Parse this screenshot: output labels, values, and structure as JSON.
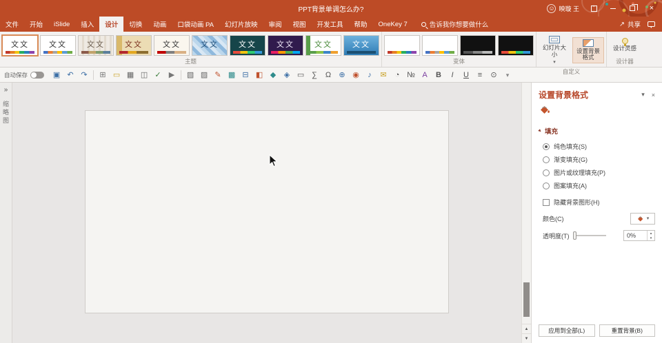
{
  "window": {
    "title": "PPT背景单调怎么办?",
    "user_name": "映璇 王"
  },
  "tabs": [
    {
      "label": "文件"
    },
    {
      "label": "开始"
    },
    {
      "label": "iSlide"
    },
    {
      "label": "插入"
    },
    {
      "label": "设计"
    },
    {
      "label": "切换"
    },
    {
      "label": "动画"
    },
    {
      "label": "口袋动画 PA"
    },
    {
      "label": "幻灯片放映"
    },
    {
      "label": "审阅"
    },
    {
      "label": "视图"
    },
    {
      "label": "开发工具"
    },
    {
      "label": "帮助"
    },
    {
      "label": "OneKey 7"
    }
  ],
  "search": {
    "placeholder": "告诉我你想要做什么"
  },
  "actions": {
    "share_label": "共享"
  },
  "ribbon": {
    "groups": {
      "themes_label": "主题",
      "variants_label": "变体",
      "customize_label": "自定义",
      "designer_label": "设计器"
    },
    "themes": [
      {
        "label": "文文",
        "box_style": "background:#ffffff;color:#333333",
        "strip_style": "background:linear-gradient(90deg,#c0392b 0 16%,#e67e22 16% 32%,#f1c40f 32% 48%,#27ae60 48% 64%,#2980b9 64% 82%,#8e44ad 82%)"
      },
      {
        "label": "文文",
        "box_style": "background:#ffffff;color:#333333",
        "strip_style": "background:linear-gradient(90deg,#4472c4 0 16%,#ed7d31 16% 32%,#a5a5a5 32% 48%,#ffc000 48% 64%,#5b9bd5 64% 82%,#70ad47 82%)"
      },
      {
        "label": "文文",
        "box_style": "background:repeating-linear-gradient(90deg,#efeae3 0 5px,#e2dace 5px 8px);color:#6b5d4f",
        "strip_style": "background:linear-gradient(90deg,#8c5a4a 0 25%,#c2a36b 25% 50%,#7f9c6c 50% 75%,#5b7f9c 75%)"
      },
      {
        "label": "文文",
        "box_style": "background:linear-gradient(90deg,#d9b96a 0 8px,#ecdcb4 8px);color:#7a2f1d",
        "strip_style": "background:linear-gradient(90deg,#b3272d 0 30%,#e3a71f 30% 60%,#8c6d2f 60%)"
      },
      {
        "label": "文文",
        "box_style": "background:#faf6ee;color:#333333",
        "strip_style": "background:linear-gradient(90deg,#c00000 0 30%,#7f7f7f 30% 60%,#d9b084 60%)"
      },
      {
        "label": "文文",
        "box_style": "background:repeating-linear-gradient(45deg,#bcd7ec 0 5px,#8fb9dd 5px 10px,#d8e7f4 10px 15px);color:#1f4e79",
        "strip_style": "display:none"
      },
      {
        "label": "文文",
        "box_style": "background:#16454a;color:#ffffff",
        "strip_style": "background:linear-gradient(90deg,#e74c3c 0 25%,#f1c40f 25% 50%,#2ecc71 50% 75%,#3498db 75%)"
      },
      {
        "label": "文文",
        "box_style": "background:#301b4d;color:#efe7f7",
        "strip_style": "background:linear-gradient(90deg,#e91e63 0 25%,#ff9800 25% 50%,#4caf50 50% 75%,#03a9f4 75%)"
      },
      {
        "label": "文文",
        "box_style": "background:linear-gradient(90deg,#5a9e4a 0 6px,#ffffff 6px);color:#4a8a3a",
        "strip_style": "background:linear-gradient(90deg,#5a9e4a 0 25%,#8bc34a 25% 50%,#3d85c8 50% 75%,#f0a030 75%)"
      },
      {
        "label": "文文",
        "box_style": "background:linear-gradient(180deg,#6db1dd,#2f7cb5);color:#ffffff",
        "strip_style": "background:#1b4f72"
      }
    ],
    "variants": [
      {
        "box_style": "background:#ffffff",
        "strip_style": "background:linear-gradient(90deg,#c0392b 0 16%,#e67e22 16% 32%,#f1c40f 32% 48%,#27ae60 48% 64%,#2980b9 64% 82%,#8e44ad 82%)"
      },
      {
        "box_style": "background:#ffffff",
        "strip_style": "background:linear-gradient(90deg,#4472c4 0 16%,#ed7d31 16% 32%,#a5a5a5 32% 48%,#ffc000 48% 64%,#5b9bd5 64% 82%,#70ad47 82%)"
      },
      {
        "box_style": "background:#111111",
        "strip_style": "background:linear-gradient(90deg,#555555 0 33%,#888888 33% 66%,#bbbbbb 66%)"
      },
      {
        "box_style": "background:#111111",
        "strip_style": "background:linear-gradient(90deg,#e74c3c 0 25%,#f1c40f 25% 50%,#2ecc71 50% 75%,#3498db 75%)"
      }
    ],
    "buttons": {
      "slide_size": "幻灯片大小",
      "format_background": "设置背景格式",
      "design_ideas": "设计灵感"
    }
  },
  "qat": {
    "autosave_label": "自动保存",
    "icons": [
      {
        "name": "save-icon",
        "glyph": "▣",
        "style": "color:#3b6ea5"
      },
      {
        "name": "undo-icon",
        "glyph": "↶",
        "style": "color:#3b6ea5"
      },
      {
        "name": "redo-icon",
        "glyph": "↷",
        "style": "color:#3b6ea5"
      },
      {
        "name": "new-slide-icon",
        "glyph": "⊞",
        "style": "color:#777777"
      },
      {
        "name": "open-icon",
        "glyph": "▭",
        "style": "color:#c9a227"
      },
      {
        "name": "print-icon",
        "glyph": "▦",
        "style": "color:#666666"
      },
      {
        "name": "print-preview-icon",
        "glyph": "◫",
        "style": "color:#666666"
      },
      {
        "name": "spelling-icon",
        "glyph": "✓",
        "style": "color:#3a7c3a"
      },
      {
        "name": "slideshow-icon",
        "glyph": "▶",
        "style": "color:#777777"
      },
      {
        "name": "copy-icon",
        "glyph": "▧",
        "style": "color:#666666"
      },
      {
        "name": "paste-icon",
        "glyph": "▨",
        "style": "color:#666666"
      },
      {
        "name": "format-painter-icon",
        "glyph": "✎",
        "style": "color:#c0532f"
      },
      {
        "name": "picture-icon",
        "glyph": "▩",
        "style": "color:#2e8b8b"
      },
      {
        "name": "table-icon",
        "glyph": "⊟",
        "style": "color:#3b6ea5"
      },
      {
        "name": "chart-icon",
        "glyph": "◧",
        "style": "color:#c0532f"
      },
      {
        "name": "shapes-icon",
        "glyph": "◆",
        "style": "color:#2e8b8b"
      },
      {
        "name": "smartart-icon",
        "glyph": "◈",
        "style": "color:#3b6ea5"
      },
      {
        "name": "text-box-icon",
        "glyph": "▭",
        "style": "color:#555555"
      },
      {
        "name": "equation-icon",
        "glyph": "∑",
        "style": "color:#555555"
      },
      {
        "name": "symbol-icon",
        "glyph": "Ω",
        "style": "color:#555555"
      },
      {
        "name": "hyperlink-icon",
        "glyph": "⊕",
        "style": "color:#3b6ea5"
      },
      {
        "name": "video-icon",
        "glyph": "◉",
        "style": "color:#c0532f"
      },
      {
        "name": "audio-icon",
        "glyph": "♪",
        "style": "color:#3b6ea5"
      },
      {
        "name": "comment-icon",
        "glyph": "✉",
        "style": "color:#c9a227"
      },
      {
        "name": "date-time-icon",
        "glyph": "◔",
        "style": "color:#555555"
      },
      {
        "name": "slide-number-icon",
        "glyph": "№",
        "style": "color:#555555"
      },
      {
        "name": "wordart-icon",
        "glyph": "A",
        "style": "color:#7b3fa0"
      },
      {
        "name": "bold-icon",
        "glyph": "B",
        "style": "color:#555555;font-weight:bold"
      },
      {
        "name": "italic-icon",
        "glyph": "I",
        "style": "color:#555555;font-style:italic"
      },
      {
        "name": "underline-icon",
        "glyph": "U",
        "style": "color:#555555;text-decoration:underline"
      },
      {
        "name": "align-icon",
        "glyph": "≡",
        "style": "color:#555555"
      },
      {
        "name": "zoom-icon",
        "glyph": "⊙",
        "style": "color:#555555"
      }
    ]
  },
  "left_pane": {
    "label": "缩略图"
  },
  "panel": {
    "title": "设置背景格式",
    "fill_section_label": "填充",
    "options": [
      {
        "label": "纯色填充(S)"
      },
      {
        "label": "渐变填充(G)"
      },
      {
        "label": "图片或纹理填充(P)"
      },
      {
        "label": "图案填充(A)"
      },
      {
        "label": "隐藏背景图形(H)"
      }
    ],
    "color_label": "颜色(C)",
    "transparency_label": "透明度(T)",
    "transparency_value": "0%",
    "apply_all_label": "应用到全部(L)",
    "reset_label": "重置背景(B)"
  },
  "icons": {
    "chevron_down": "▾",
    "close": "×",
    "spin_up": "▴",
    "spin_down": "▾",
    "section_triangle": "▴",
    "collapse": "»",
    "prev": "▲",
    "next": "▼",
    "share_arrow": "↗",
    "smiley": "☺",
    "more": "▾"
  },
  "colors": {
    "titlebar": "#bd4b26",
    "accent": "#b7472a"
  }
}
